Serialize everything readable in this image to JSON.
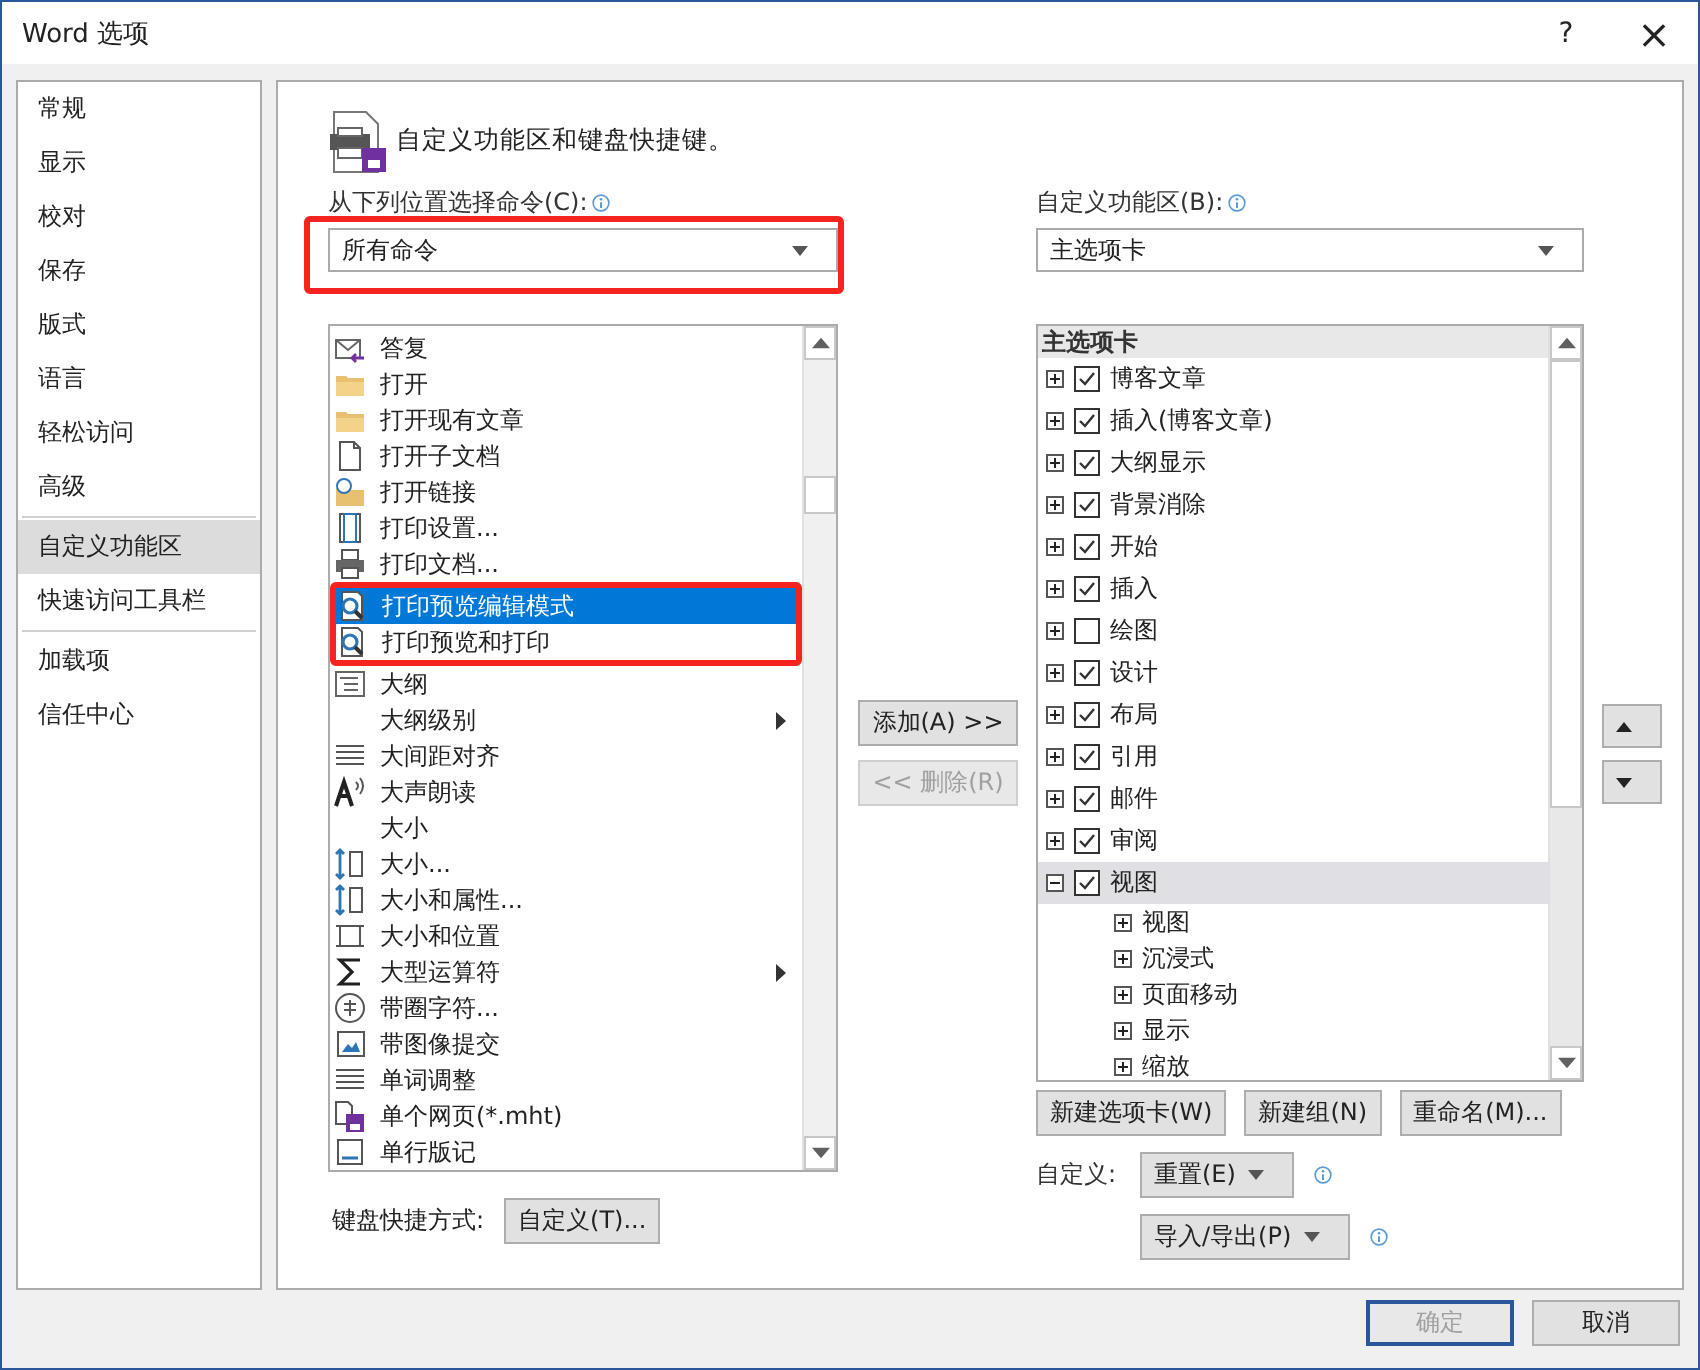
{
  "window": {
    "title": "Word 选项",
    "help": "?",
    "close": "×"
  },
  "sidebar": {
    "items": [
      {
        "label": "常规",
        "selected": false,
        "divider_after": false
      },
      {
        "label": "显示",
        "selected": false,
        "divider_after": false
      },
      {
        "label": "校对",
        "selected": false,
        "divider_after": false
      },
      {
        "label": "保存",
        "selected": false,
        "divider_after": false
      },
      {
        "label": "版式",
        "selected": false,
        "divider_after": false
      },
      {
        "label": "语言",
        "selected": false,
        "divider_after": false
      },
      {
        "label": "轻松访问",
        "selected": false,
        "divider_after": false
      },
      {
        "label": "高级",
        "selected": false,
        "divider_after": true
      },
      {
        "label": "自定义功能区",
        "selected": true,
        "divider_after": false
      },
      {
        "label": "快速访问工具栏",
        "selected": false,
        "divider_after": true
      },
      {
        "label": "加载项",
        "selected": false,
        "divider_after": false
      },
      {
        "label": "信任中心",
        "selected": false,
        "divider_after": false
      }
    ]
  },
  "heading": "自定义功能区和键盘快捷键。",
  "commands": {
    "label": "从下列位置选择命令(C):",
    "source": "所有命令",
    "highlighted": true,
    "items": [
      {
        "label": "答复",
        "selected": false,
        "has_submenu": false
      },
      {
        "label": "打开",
        "selected": false,
        "has_submenu": false
      },
      {
        "label": "打开现有文章",
        "selected": false,
        "has_submenu": false
      },
      {
        "label": "打开子文档",
        "selected": false,
        "has_submenu": false
      },
      {
        "label": "打开链接",
        "selected": false,
        "has_submenu": false
      },
      {
        "label": "打印设置...",
        "selected": false,
        "has_submenu": false
      },
      {
        "label": "打印文档...",
        "selected": false,
        "has_submenu": false
      },
      {
        "label": "打印预览编辑模式",
        "selected": true,
        "has_submenu": false,
        "highlighted": true
      },
      {
        "label": "打印预览和打印",
        "selected": false,
        "has_submenu": false,
        "highlighted": true
      },
      {
        "label": "大纲",
        "selected": false,
        "has_submenu": false
      },
      {
        "label": "大纲级别",
        "selected": false,
        "has_submenu": true
      },
      {
        "label": "大间距对齐",
        "selected": false,
        "has_submenu": false
      },
      {
        "label": "大声朗读",
        "selected": false,
        "has_submenu": false
      },
      {
        "label": "大小",
        "selected": false,
        "has_submenu": false
      },
      {
        "label": "大小...",
        "selected": false,
        "has_submenu": false
      },
      {
        "label": "大小和属性...",
        "selected": false,
        "has_submenu": false
      },
      {
        "label": "大小和位置",
        "selected": false,
        "has_submenu": false
      },
      {
        "label": "大型运算符",
        "selected": false,
        "has_submenu": true
      },
      {
        "label": "带圈字符...",
        "selected": false,
        "has_submenu": false
      },
      {
        "label": "带图像提交",
        "selected": false,
        "has_submenu": false
      },
      {
        "label": "单词调整",
        "selected": false,
        "has_submenu": false
      },
      {
        "label": "单个网页(*.mht)",
        "selected": false,
        "has_submenu": false
      },
      {
        "label": "单行版记",
        "selected": false,
        "has_submenu": false
      }
    ],
    "shortcut_label": "键盘快捷方式:",
    "shortcut_button": "自定义(T)..."
  },
  "add_button": {
    "label": "添加(A) >>",
    "disabled": false
  },
  "remove_button": {
    "label": "<< 删除(R)",
    "disabled": true
  },
  "ribbon": {
    "label": "自定义功能区(B):",
    "selection": "主选项卡",
    "header": "主选项卡",
    "items": [
      {
        "label": "博客文章",
        "checked": true,
        "expanded": false,
        "selected": false
      },
      {
        "label": "插入(博客文章)",
        "checked": true,
        "expanded": false,
        "selected": false
      },
      {
        "label": "大纲显示",
        "checked": true,
        "expanded": false,
        "selected": false
      },
      {
        "label": "背景消除",
        "checked": true,
        "expanded": false,
        "selected": false
      },
      {
        "label": "开始",
        "checked": true,
        "expanded": false,
        "selected": false
      },
      {
        "label": "插入",
        "checked": true,
        "expanded": false,
        "selected": false
      },
      {
        "label": "绘图",
        "checked": false,
        "expanded": false,
        "selected": false
      },
      {
        "label": "设计",
        "checked": true,
        "expanded": false,
        "selected": false
      },
      {
        "label": "布局",
        "checked": true,
        "expanded": false,
        "selected": false
      },
      {
        "label": "引用",
        "checked": true,
        "expanded": false,
        "selected": false
      },
      {
        "label": "邮件",
        "checked": true,
        "expanded": false,
        "selected": false
      },
      {
        "label": "审阅",
        "checked": true,
        "expanded": false,
        "selected": false
      },
      {
        "label": "视图",
        "checked": true,
        "expanded": true,
        "selected": true,
        "children": [
          {
            "label": "视图",
            "expanded": false
          },
          {
            "label": "沉浸式",
            "expanded": false
          },
          {
            "label": "页面移动",
            "expanded": false
          },
          {
            "label": "显示",
            "expanded": false
          },
          {
            "label": "缩放",
            "expanded": false
          }
        ]
      }
    ],
    "buttons": [
      "新建选项卡(W)",
      "新建组(N)",
      "重命名(M)..."
    ],
    "customize_label": "自定义:",
    "reset": "重置(E)",
    "import_export": "导入/导出(P)"
  },
  "footer": {
    "ok": {
      "label": "确定",
      "disabled": true,
      "default": true
    },
    "cancel": {
      "label": "取消",
      "disabled": false
    }
  }
}
